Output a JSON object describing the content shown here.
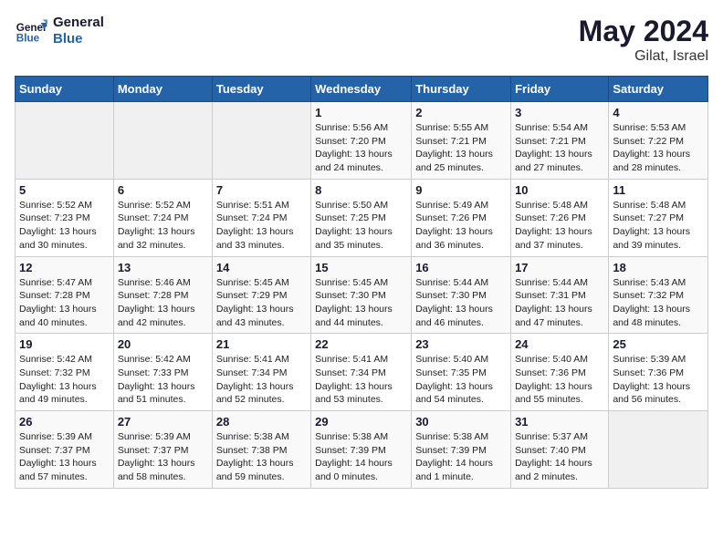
{
  "header": {
    "logo_line1": "General",
    "logo_line2": "Blue",
    "month_title": "May 2024",
    "location": "Gilat, Israel"
  },
  "days_of_week": [
    "Sunday",
    "Monday",
    "Tuesday",
    "Wednesday",
    "Thursday",
    "Friday",
    "Saturday"
  ],
  "weeks": [
    [
      {
        "day": "",
        "info": ""
      },
      {
        "day": "",
        "info": ""
      },
      {
        "day": "",
        "info": ""
      },
      {
        "day": "1",
        "info": "Sunrise: 5:56 AM\nSunset: 7:20 PM\nDaylight: 13 hours\nand 24 minutes."
      },
      {
        "day": "2",
        "info": "Sunrise: 5:55 AM\nSunset: 7:21 PM\nDaylight: 13 hours\nand 25 minutes."
      },
      {
        "day": "3",
        "info": "Sunrise: 5:54 AM\nSunset: 7:21 PM\nDaylight: 13 hours\nand 27 minutes."
      },
      {
        "day": "4",
        "info": "Sunrise: 5:53 AM\nSunset: 7:22 PM\nDaylight: 13 hours\nand 28 minutes."
      }
    ],
    [
      {
        "day": "5",
        "info": "Sunrise: 5:52 AM\nSunset: 7:23 PM\nDaylight: 13 hours\nand 30 minutes."
      },
      {
        "day": "6",
        "info": "Sunrise: 5:52 AM\nSunset: 7:24 PM\nDaylight: 13 hours\nand 32 minutes."
      },
      {
        "day": "7",
        "info": "Sunrise: 5:51 AM\nSunset: 7:24 PM\nDaylight: 13 hours\nand 33 minutes."
      },
      {
        "day": "8",
        "info": "Sunrise: 5:50 AM\nSunset: 7:25 PM\nDaylight: 13 hours\nand 35 minutes."
      },
      {
        "day": "9",
        "info": "Sunrise: 5:49 AM\nSunset: 7:26 PM\nDaylight: 13 hours\nand 36 minutes."
      },
      {
        "day": "10",
        "info": "Sunrise: 5:48 AM\nSunset: 7:26 PM\nDaylight: 13 hours\nand 37 minutes."
      },
      {
        "day": "11",
        "info": "Sunrise: 5:48 AM\nSunset: 7:27 PM\nDaylight: 13 hours\nand 39 minutes."
      }
    ],
    [
      {
        "day": "12",
        "info": "Sunrise: 5:47 AM\nSunset: 7:28 PM\nDaylight: 13 hours\nand 40 minutes."
      },
      {
        "day": "13",
        "info": "Sunrise: 5:46 AM\nSunset: 7:28 PM\nDaylight: 13 hours\nand 42 minutes."
      },
      {
        "day": "14",
        "info": "Sunrise: 5:45 AM\nSunset: 7:29 PM\nDaylight: 13 hours\nand 43 minutes."
      },
      {
        "day": "15",
        "info": "Sunrise: 5:45 AM\nSunset: 7:30 PM\nDaylight: 13 hours\nand 44 minutes."
      },
      {
        "day": "16",
        "info": "Sunrise: 5:44 AM\nSunset: 7:30 PM\nDaylight: 13 hours\nand 46 minutes."
      },
      {
        "day": "17",
        "info": "Sunrise: 5:44 AM\nSunset: 7:31 PM\nDaylight: 13 hours\nand 47 minutes."
      },
      {
        "day": "18",
        "info": "Sunrise: 5:43 AM\nSunset: 7:32 PM\nDaylight: 13 hours\nand 48 minutes."
      }
    ],
    [
      {
        "day": "19",
        "info": "Sunrise: 5:42 AM\nSunset: 7:32 PM\nDaylight: 13 hours\nand 49 minutes."
      },
      {
        "day": "20",
        "info": "Sunrise: 5:42 AM\nSunset: 7:33 PM\nDaylight: 13 hours\nand 51 minutes."
      },
      {
        "day": "21",
        "info": "Sunrise: 5:41 AM\nSunset: 7:34 PM\nDaylight: 13 hours\nand 52 minutes."
      },
      {
        "day": "22",
        "info": "Sunrise: 5:41 AM\nSunset: 7:34 PM\nDaylight: 13 hours\nand 53 minutes."
      },
      {
        "day": "23",
        "info": "Sunrise: 5:40 AM\nSunset: 7:35 PM\nDaylight: 13 hours\nand 54 minutes."
      },
      {
        "day": "24",
        "info": "Sunrise: 5:40 AM\nSunset: 7:36 PM\nDaylight: 13 hours\nand 55 minutes."
      },
      {
        "day": "25",
        "info": "Sunrise: 5:39 AM\nSunset: 7:36 PM\nDaylight: 13 hours\nand 56 minutes."
      }
    ],
    [
      {
        "day": "26",
        "info": "Sunrise: 5:39 AM\nSunset: 7:37 PM\nDaylight: 13 hours\nand 57 minutes."
      },
      {
        "day": "27",
        "info": "Sunrise: 5:39 AM\nSunset: 7:37 PM\nDaylight: 13 hours\nand 58 minutes."
      },
      {
        "day": "28",
        "info": "Sunrise: 5:38 AM\nSunset: 7:38 PM\nDaylight: 13 hours\nand 59 minutes."
      },
      {
        "day": "29",
        "info": "Sunrise: 5:38 AM\nSunset: 7:39 PM\nDaylight: 14 hours\nand 0 minutes."
      },
      {
        "day": "30",
        "info": "Sunrise: 5:38 AM\nSunset: 7:39 PM\nDaylight: 14 hours\nand 1 minute."
      },
      {
        "day": "31",
        "info": "Sunrise: 5:37 AM\nSunset: 7:40 PM\nDaylight: 14 hours\nand 2 minutes."
      },
      {
        "day": "",
        "info": ""
      }
    ]
  ]
}
